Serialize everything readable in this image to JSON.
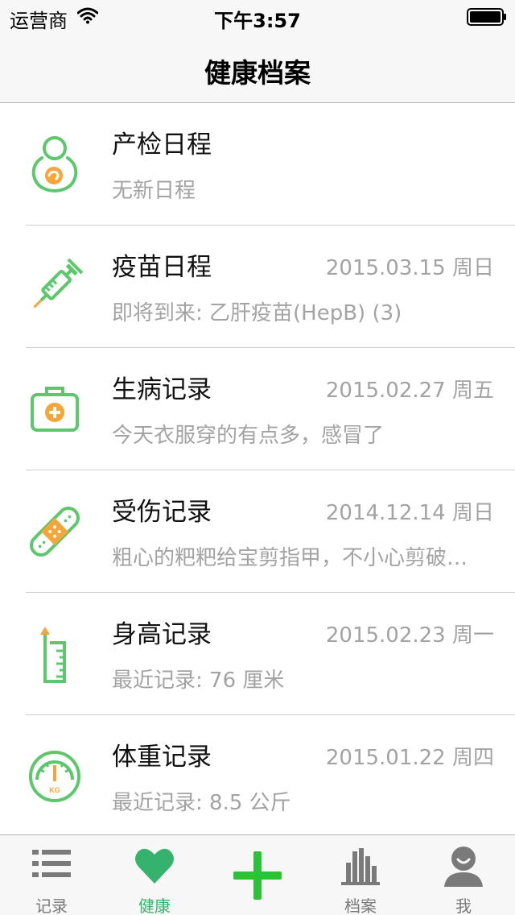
{
  "status_bar": {
    "carrier": "运营商",
    "time": "下午3:57"
  },
  "nav": {
    "title": "健康档案"
  },
  "colors": {
    "green": "#5cc76b",
    "orange": "#f5a53a",
    "gray_text": "#a3a3a3",
    "tab_active": "#35b36c",
    "plus_green": "#2bc23a"
  },
  "rows": [
    {
      "icon": "pregnancy-icon",
      "title": "产检日程",
      "date": "",
      "subtitle": "无新日程"
    },
    {
      "icon": "syringe-icon",
      "title": "疫苗日程",
      "date": "2015.03.15 周日",
      "subtitle": "即将到来: 乙肝疫苗(HepB) (3)"
    },
    {
      "icon": "medical-kit-icon",
      "title": "生病记录",
      "date": "2015.02.27 周五",
      "subtitle": "今天衣服穿的有点多，感冒了"
    },
    {
      "icon": "bandage-icon",
      "title": "受伤记录",
      "date": "2014.12.14 周日",
      "subtitle": "粗心的粑粑给宝剪指甲，不小心剪破…"
    },
    {
      "icon": "ruler-icon",
      "title": "身高记录",
      "date": "2015.02.23 周一",
      "subtitle": "最近记录: 76 厘米"
    },
    {
      "icon": "scale-icon",
      "title": "体重记录",
      "date": "2015.01.22 周四",
      "subtitle": "最近记录: 8.5 公斤"
    }
  ],
  "scale_icon_text": "KG",
  "tabs": [
    {
      "icon": "list-icon",
      "label": "记录",
      "active": false
    },
    {
      "icon": "heart-icon",
      "label": "健康",
      "active": true
    },
    {
      "icon": "plus-icon",
      "label": "",
      "active": false
    },
    {
      "icon": "archive-chart-icon",
      "label": "档案",
      "active": false
    },
    {
      "icon": "user-icon",
      "label": "我",
      "active": false
    }
  ]
}
